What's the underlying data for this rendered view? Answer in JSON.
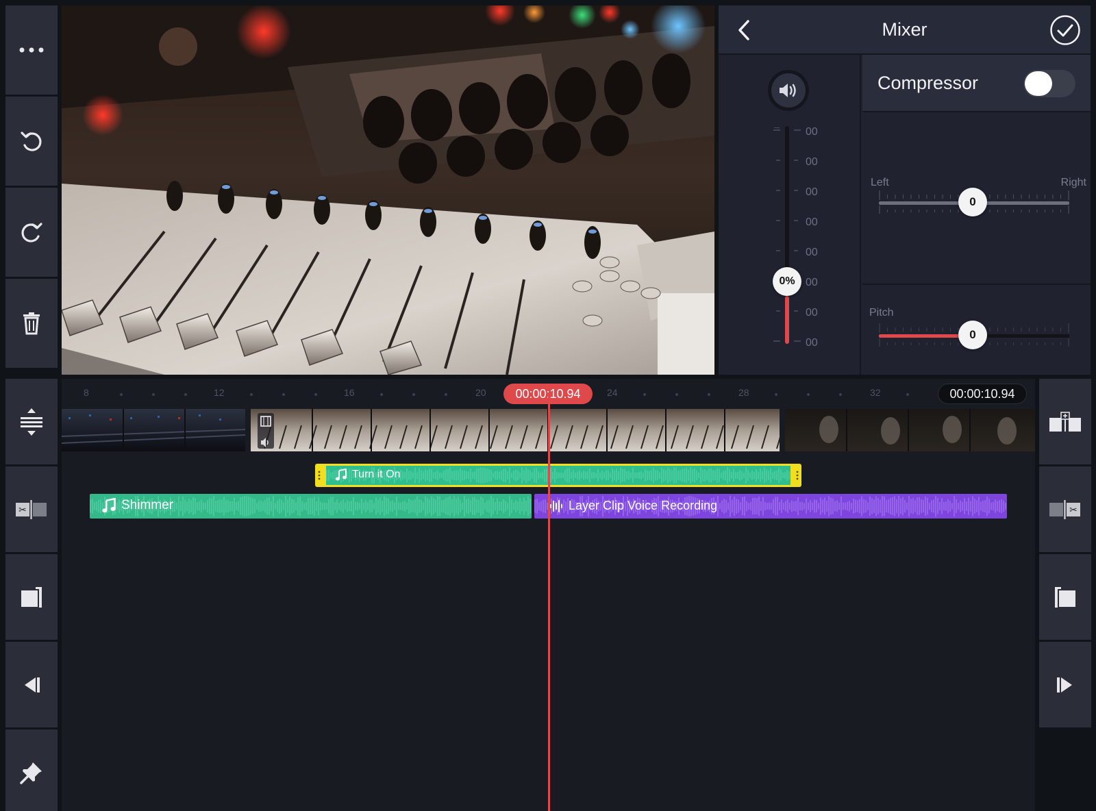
{
  "left_toolbar": {
    "top": [
      "more-icon",
      "undo-icon",
      "redo-icon",
      "trash-icon"
    ],
    "bottom": [
      "split-vertical-icon",
      "trim-split-icon",
      "crop-left-icon",
      "skip-back-icon",
      "pin-icon"
    ]
  },
  "right_toolbar": [
    "insert-clip-icon",
    "trim-split-right-icon",
    "crop-right-icon",
    "skip-forward-icon"
  ],
  "mixer": {
    "title": "Mixer",
    "volume_percent": "0%",
    "volume_fill": 0.0,
    "db_labels": [
      "00",
      "00",
      "00",
      "00",
      "00",
      "00",
      "00",
      "00"
    ],
    "compressor_label": "Compressor",
    "compressor_on": false,
    "pan": {
      "left_label": "Left",
      "right_label": "Right",
      "value": "0"
    },
    "pitch": {
      "label": "Pitch",
      "value": "0"
    }
  },
  "timeline": {
    "ruler_numbers": [
      "8",
      "12",
      "16",
      "20",
      "24",
      "28",
      "32"
    ],
    "playhead_time": "00:00:10.94",
    "end_time": "00:00:10.94",
    "clips": {
      "turn_it_on": "Turn it On",
      "shimmer": "Shimmer",
      "voice": "Layer Clip Voice Recording"
    }
  },
  "colors": {
    "accent_red": "#e0494c",
    "clip_green": "#33b98a",
    "clip_yellow": "#f1df1f",
    "clip_purple": "#7d45dd"
  }
}
